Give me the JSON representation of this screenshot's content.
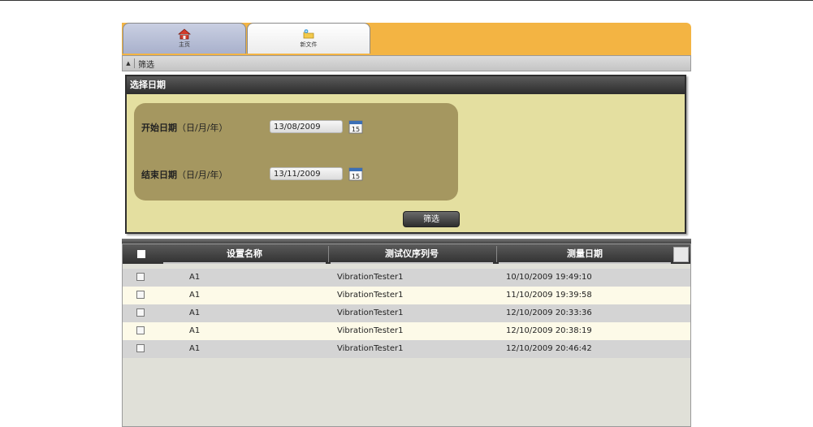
{
  "tabs": [
    {
      "label": "主页",
      "icon": "home-icon"
    },
    {
      "label": "新文件",
      "icon": "new-file-icon"
    }
  ],
  "filter": {
    "header_label": "筛选",
    "panel_title": "选择日期",
    "start": {
      "label_bold": "开始日期",
      "label_rest": "（日/月/年）",
      "value": "13/08/2009"
    },
    "end": {
      "label_bold": "结束日期",
      "label_rest": "（日/月/年）",
      "value": "13/11/2009"
    },
    "calendar_day": "15",
    "button_label": "筛选"
  },
  "grid": {
    "columns": [
      "设置名称",
      "测试仪序列号",
      "测量日期"
    ],
    "rows": [
      {
        "name": "A1",
        "serial": "VibrationTester1",
        "date": "10/10/2009 19:49:10"
      },
      {
        "name": "A1",
        "serial": "VibrationTester1",
        "date": "11/10/2009 19:39:58"
      },
      {
        "name": "A1",
        "serial": "VibrationTester1",
        "date": "12/10/2009 20:33:36"
      },
      {
        "name": "A1",
        "serial": "VibrationTester1",
        "date": "12/10/2009 20:38:19"
      },
      {
        "name": "A1",
        "serial": "VibrationTester1",
        "date": "12/10/2009 20:46:42"
      }
    ]
  },
  "colors": {
    "tab_bar": "#f3b443",
    "panel": "#e4dfa0",
    "date_box": "#a59760",
    "row_odd": "#d4d4d4",
    "row_even": "#fdfae8"
  }
}
